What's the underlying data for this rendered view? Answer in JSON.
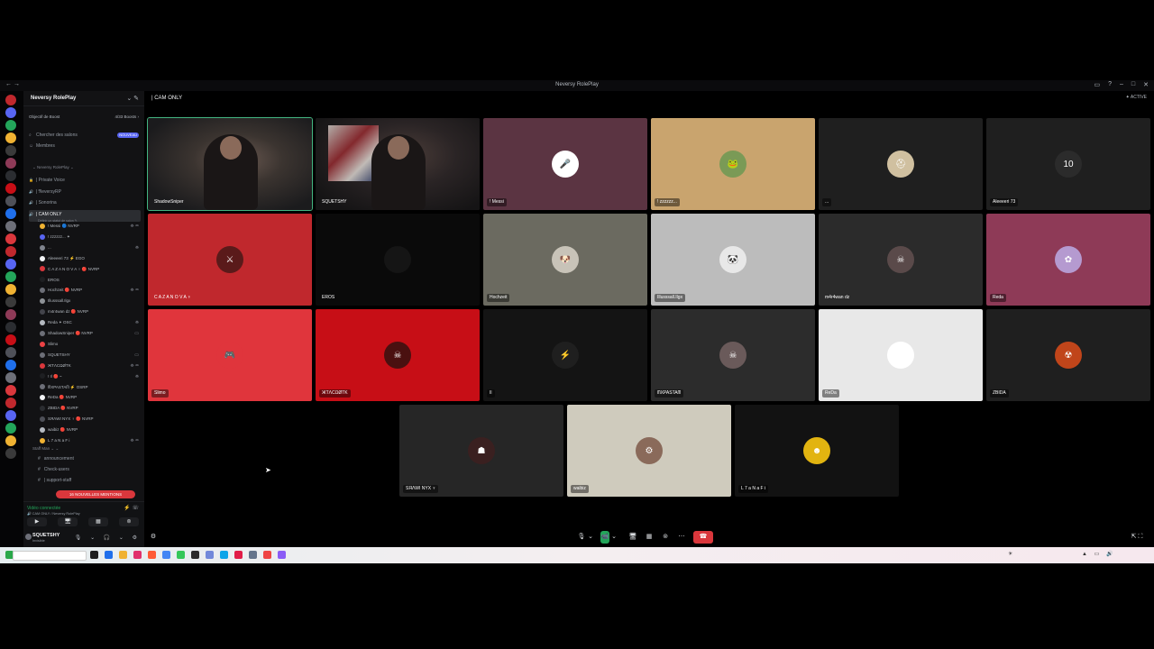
{
  "window": {
    "title": "Neversy RolePlay",
    "nav": "←  →"
  },
  "server": {
    "name": "Neversy RolePlay",
    "header_icons": "⌄  ✎"
  },
  "boost": {
    "label": "Objectif de Boost",
    "value": "4/33 Boosts ›"
  },
  "top_items": [
    {
      "label": "Chercher des salons",
      "badge": "NOUVEAU",
      "icon": "search-icon",
      "glyph": "⌕"
    },
    {
      "label": "Membres",
      "icon": "members-icon",
      "glyph": "☺"
    }
  ],
  "category": "⌄ Neversy RolePlay ⌄",
  "channels": [
    {
      "label": "| Private Voice",
      "glyph": "🔒"
    },
    {
      "label": "| 𝔑eversyRP",
      "glyph": "🔊"
    },
    {
      "label": "| Sonorina",
      "glyph": "🔊"
    },
    {
      "label": "| CAM ONLY",
      "glyph": "🔊",
      "active": true,
      "subtitle": "Définir un statut de salon ✎"
    }
  ],
  "members": [
    {
      "name": "! Messi  🔵 NVRP",
      "color": "#f0b232",
      "icons": "⛯ ▭"
    },
    {
      "name": "! zzzzzz... ✦",
      "color": "#5865f2",
      "icons": ""
    },
    {
      "name": "...",
      "color": "#80848e",
      "icons": "⛯"
    },
    {
      "name": "Aleeeeri 73  ⚡ EGO",
      "color": "#f2f3f5",
      "icons": ""
    },
    {
      "name": "C A Z A N O V A ♆  🔴 NVRP",
      "color": "#da373c",
      "icons": ""
    },
    {
      "name": "EROS",
      "color": "#1e1f22",
      "icons": ""
    },
    {
      "name": "Hochzeit  🔴 NVRP",
      "color": "#6d6f78",
      "icons": "⛯ ▭"
    },
    {
      "name": "Illusssall.Ilgx",
      "color": "#8e9297",
      "icons": ""
    },
    {
      "name": "m4r4wan dz  🔴 NVRP",
      "color": "#43444b",
      "icons": ""
    },
    {
      "name": "Reda  ✦ OSC",
      "color": "#b5bac1",
      "icons": "⛯"
    },
    {
      "name": "ShadowSniper  🔴 NVRP",
      "color": "#6d6f78",
      "icons": "▭"
    },
    {
      "name": "Slimo",
      "color": "#ed4245",
      "icons": ""
    },
    {
      "name": "SQUETSHY",
      "color": "#6d6f78",
      "icons": "▭"
    },
    {
      "name": "ЖTΛCΩØTK",
      "color": "#da373c",
      "icons": "⛯ ▭"
    },
    {
      "name": "! Il 🔴 ~",
      "color": "#1e1f22",
      "icons": "⛯"
    },
    {
      "name": "ᗰXPASTAᗰ  ⚡ OSRP",
      "color": "#6d6f78",
      "icons": ""
    },
    {
      "name": "ReDa  🔴 NVRP",
      "color": "#f2f3f5",
      "icons": ""
    },
    {
      "name": "ZBIDA  🔴 NVRP",
      "color": "#2b2d31",
      "icons": ""
    },
    {
      "name": "SЯΛWI NYX ♆  🔴 NVRP",
      "color": "#4e5058",
      "icons": ""
    },
    {
      "name": "waibiz  🔴 NVRP",
      "color": "#b5bac1",
      "icons": ""
    },
    {
      "name": "L 7 a N a F i",
      "color": "#f0b232",
      "icons": "⛯ ▭"
    }
  ],
  "staff_category": "Staff Man ⌄ ⌄",
  "staff_channels": [
    {
      "label": "announcement",
      "glyph": "#"
    },
    {
      "label": "Check-users",
      "glyph": "#"
    },
    {
      "label": "| support-staff",
      "glyph": "#"
    }
  ],
  "mentions": "16 NOUVELLES MENTIONS",
  "voice": {
    "status": "Vidéo connectée",
    "sub": "🔊 CAM ONLY / Neversy RolePlay",
    "icons": "⚡ ☏",
    "buttons": [
      "▶",
      "🖥",
      "▦",
      "⊚"
    ]
  },
  "user": {
    "name": "SQUETSHY",
    "status": "Invisible",
    "icons": "🎙 ⌄ 🎧 ⌄ ⚙"
  },
  "channel_header": {
    "name": "| CAM ONLY",
    "badge": "✦ ACTIVE"
  },
  "tiles": [
    {
      "name": "ShadowSniper",
      "bg": "#2a2a2a",
      "cam": true,
      "speaking": true,
      "av": "#3a3a3a",
      "glyph": ""
    },
    {
      "name": "SQUETSHY",
      "bg": "#2b2624",
      "cam": true,
      "av": "#3a3a3a",
      "glyph": ""
    },
    {
      "name": "! Messi",
      "bg": "#5b3442",
      "av": "#ffffff",
      "glyph": "🎤"
    },
    {
      "name": "! zzzzzz...",
      "bg": "#c9a46e",
      "av": "#7a9a56",
      "glyph": "🐸"
    },
    {
      "name": "...",
      "bg": "#1f1f1f",
      "av": "#d0c0a0",
      "glyph": "⛑"
    },
    {
      "name": "Aleeeeri 73",
      "bg": "#1f1f1f",
      "av": "#2b2b2b",
      "glyph": "10"
    },
    {
      "name": "C A Z A N O V A ♆",
      "bg": "#c0282d",
      "av": "#5a1a1a",
      "glyph": "⚔",
      "plain": true
    },
    {
      "name": "EROS",
      "bg": "#0a0a0a",
      "av": "#151515",
      "glyph": "",
      "plain": true
    },
    {
      "name": "Hochzeit",
      "bg": "#6b6a60",
      "av": "#c8c3b8",
      "glyph": "🐶"
    },
    {
      "name": "Illusssall.Ilgx",
      "bg": "#bcbcbc",
      "av": "#e8e8e8",
      "glyph": "🐼"
    },
    {
      "name": "m4r4wan dz",
      "bg": "#2b2b2b",
      "av": "#5a4a4a",
      "glyph": "☠",
      "plain": true
    },
    {
      "name": "Reda",
      "bg": "#8e3a57",
      "av": "#b59ad0",
      "glyph": "✿"
    },
    {
      "name": "Slimo",
      "bg": "#e0353c",
      "av": "#e0353c",
      "glyph": "🎮"
    },
    {
      "name": "ЖTΛCΩØTK",
      "bg": "#c70e16",
      "av": "#4a1010",
      "glyph": "☠"
    },
    {
      "name": "Il",
      "bg": "#141414",
      "av": "#1f1f1f",
      "glyph": "⚡"
    },
    {
      "name": "ᗰXPASTAᗰ",
      "bg": "#2c2c2c",
      "av": "#6a5a5a",
      "glyph": "☠"
    },
    {
      "name": "ReDa",
      "bg": "#e8e8e8",
      "av": "#ffffff",
      "glyph": "♟"
    },
    {
      "name": "ZBIDA",
      "bg": "#1f1f1f",
      "av": "#c0451a",
      "glyph": "☢"
    },
    {
      "name": "SЯΛWI NYX ♆",
      "bg": "#262626",
      "av": "#3a2020",
      "glyph": "☗"
    },
    {
      "name": "waibiz",
      "bg": "#cfcbbd",
      "av": "#8a6a5a",
      "glyph": "⚙"
    },
    {
      "name": "L 7 a N a F i",
      "bg": "#121212",
      "av": "#e2b410",
      "glyph": "☻"
    }
  ],
  "controls": [
    "🎙",
    "⌄",
    "📹",
    "⌄",
    "🖥",
    "▦",
    "⊚",
    "⋯",
    "☎"
  ],
  "corner_icons": {
    "left": "⚙",
    "right": "⇱  ⛶"
  }
}
